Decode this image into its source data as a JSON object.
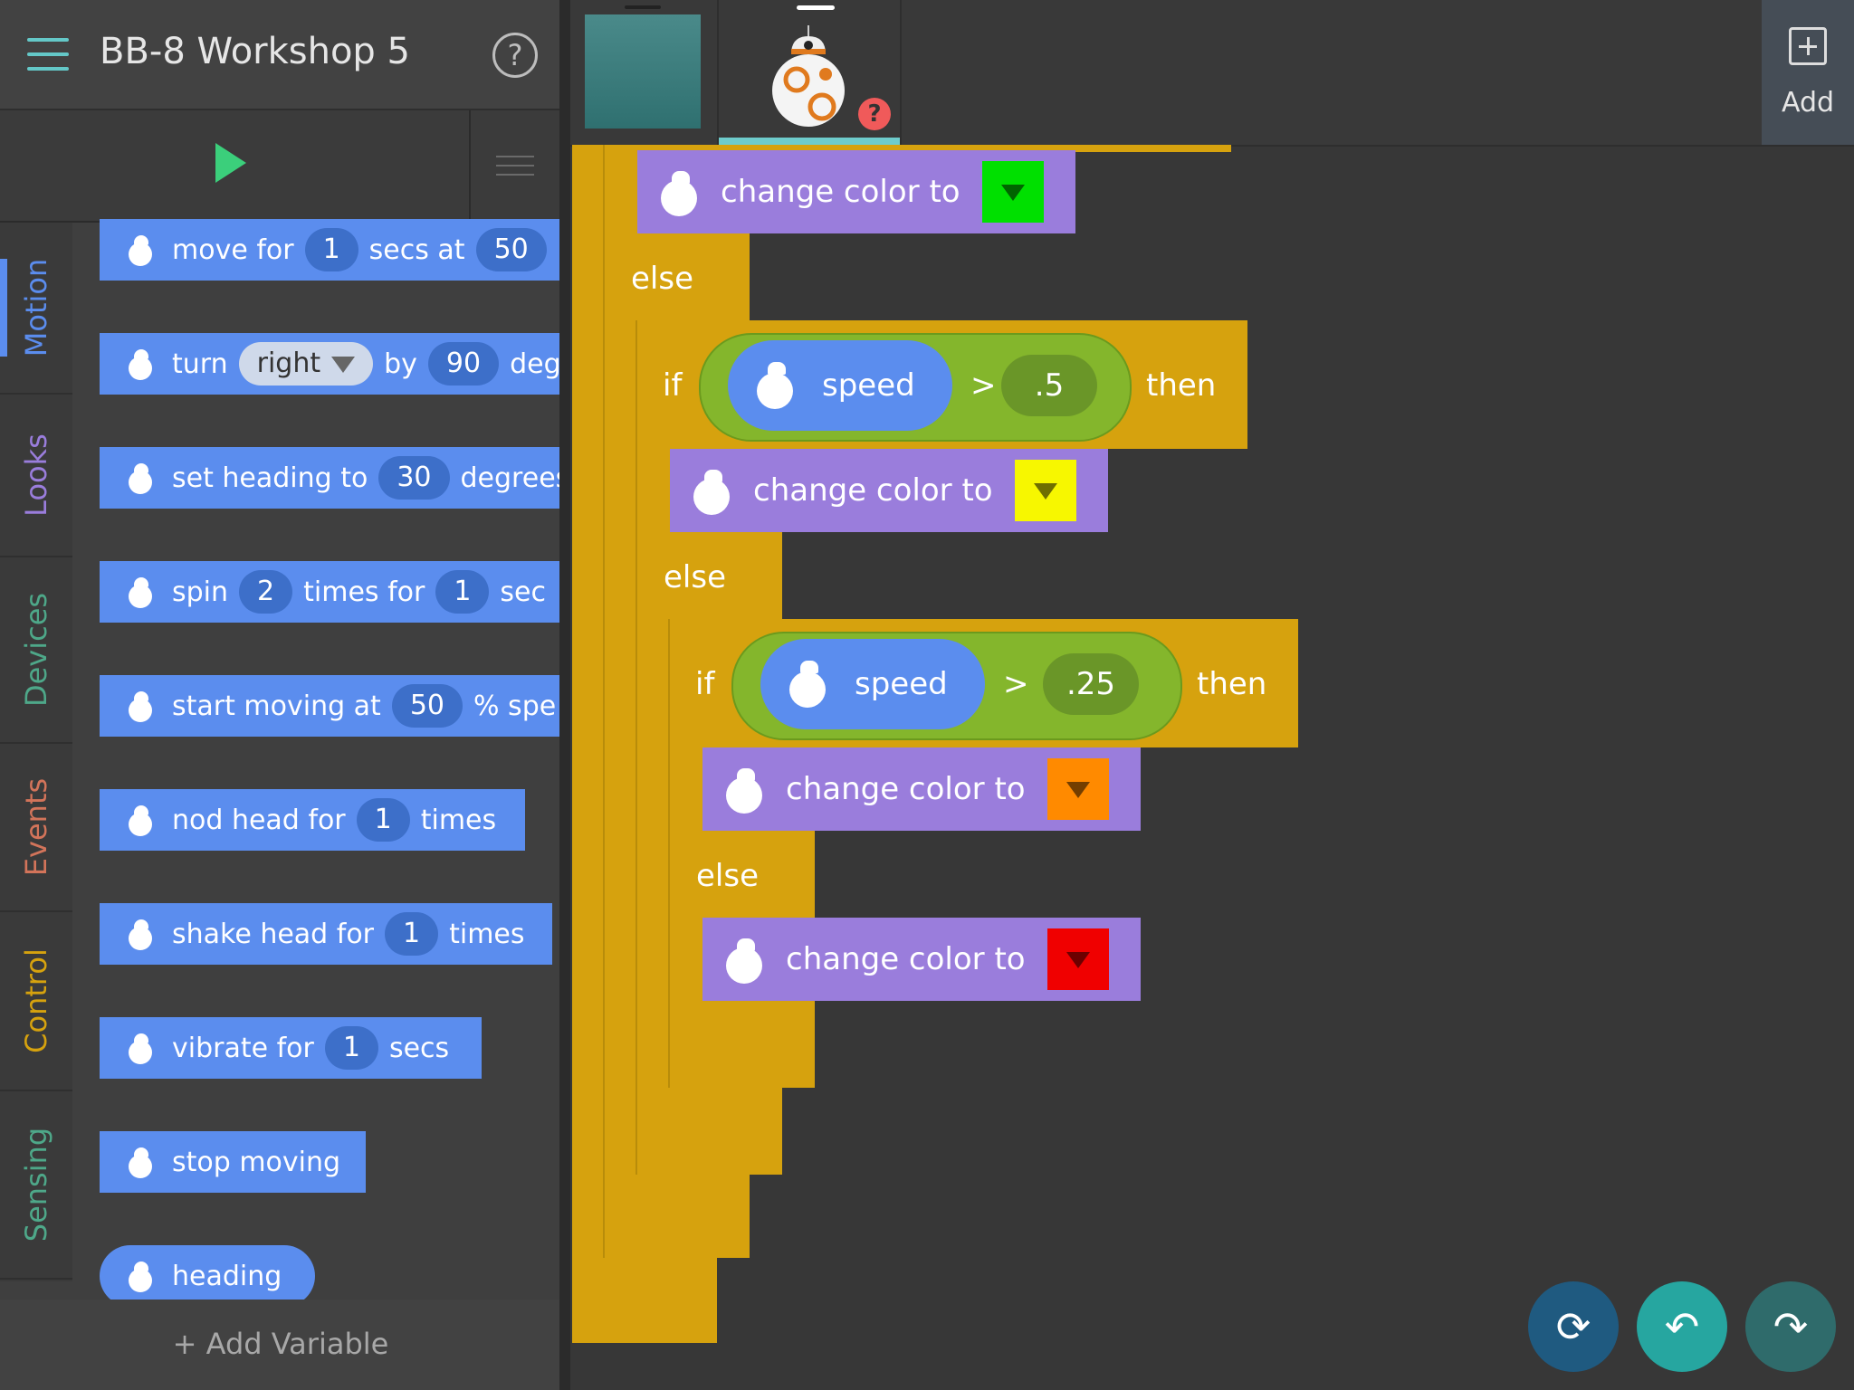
{
  "header": {
    "title": "BB-8 Workshop 5",
    "help_label": "?"
  },
  "categories": [
    {
      "label": "Motion",
      "color": "#5b8dee"
    },
    {
      "label": "Looks",
      "color": "#9a7ddc"
    },
    {
      "label": "Devices",
      "color": "#4ea889"
    },
    {
      "label": "Events",
      "color": "#d3745a"
    },
    {
      "label": "Control",
      "color": "#d6a20e"
    },
    {
      "label": "Sensing",
      "color": "#4ea889"
    }
  ],
  "palette": {
    "move": {
      "a": "move for",
      "v1": "1",
      "b": "secs at",
      "v2": "50"
    },
    "turn": {
      "a": "turn",
      "dir": "right",
      "b": "by",
      "v": "90",
      "c": "deg"
    },
    "heading": {
      "a": "set heading to",
      "v": "30",
      "b": "degrees"
    },
    "spin": {
      "a": "spin",
      "v1": "2",
      "b": "times for",
      "v2": "1",
      "c": "sec"
    },
    "start": {
      "a": "start moving at",
      "v": "50",
      "b": "% spe"
    },
    "nod": {
      "a": "nod head for",
      "v": "1",
      "b": "times"
    },
    "shake": {
      "a": "shake head for",
      "v": "1",
      "b": "times"
    },
    "vibrate": {
      "a": "vibrate for",
      "v": "1",
      "b": "secs"
    },
    "stop": {
      "a": "stop moving"
    },
    "heading_reporter": {
      "a": "heading"
    }
  },
  "add_variable": "+ Add Variable",
  "sprites": {
    "add_label": "Add",
    "warning": "?"
  },
  "script": {
    "change_color": "change color to",
    "else": "else",
    "if": "if",
    "then": "then",
    "speed": "speed",
    "gt": ">",
    "threshold_1": ".5",
    "threshold_2": ".25",
    "colors": [
      "#00e000",
      "#f7f700",
      "#ff8a00",
      "#f00000"
    ]
  },
  "icons": {
    "menu": "hamburger-icon",
    "run": "play-icon",
    "list": "list-icon",
    "add": "plus-icon",
    "undo": "undo-icon",
    "redo": "redo-icon",
    "reset": "bb8-reset-icon"
  }
}
